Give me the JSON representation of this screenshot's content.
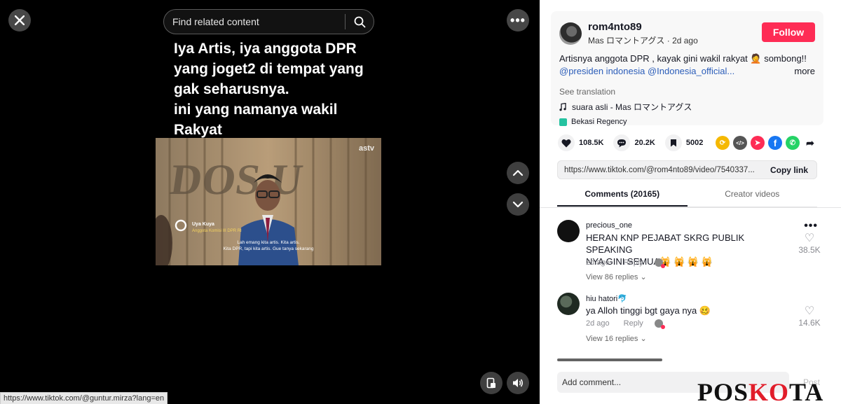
{
  "player": {
    "search_placeholder": "Find related content",
    "caption_lines": [
      "Iya Artis, iya anggota DPR",
      "yang joget2 di tempat yang",
      "gak seharusnya.",
      "ini yang namanya wakil",
      "Rakyat"
    ],
    "video_overlay": {
      "brand": "astv",
      "name": "Uya Kuya",
      "role": "Anggota Komisi III DPR RI",
      "subtitle_1": "Lah emang kita artis. Kita artis.",
      "subtitle_2": "Kita DPR, tapi kita artis. Gue tanya sekarang"
    },
    "status_url": "https://www.tiktok.com/@guntur.mirza?lang=en"
  },
  "post": {
    "username": "rom4nto89",
    "subline": "Mas ロマントアグス · 2d ago",
    "follow_label": "Follow",
    "description": "Artisnya anggota DPR , kayak gini wakil rakyat 🤦 sombong!!",
    "mentions": "@presiden indonesia @Indonesia_official...",
    "more_label": "more",
    "see_translation": "See translation",
    "music": "suara asli - Mas ロマントアグス",
    "location": "Bekasi Regency"
  },
  "stats": {
    "likes": "108.5K",
    "comments": "20.2K",
    "saves": "5002"
  },
  "share": {
    "link": "https://www.tiktok.com/@rom4nto89/video/7540337...",
    "copy_label": "Copy link"
  },
  "tabs": [
    {
      "label": "Comments (20165)",
      "active": true
    },
    {
      "label": "Creator videos",
      "active": false
    }
  ],
  "comments": [
    {
      "user": "precious_one",
      "line1": "HERAN KNP PEJABAT SKRG PUBLIK SPEAKING",
      "line2": "NYA GINI SEMUA🙀 🙀 🙀 🙀",
      "time": "2d ago",
      "reply": "Reply",
      "likes": "38.5K",
      "view_replies": "View 86 replies"
    },
    {
      "user": "hiu hatori🐬",
      "line1": "ya Alloh tinggi bgt gaya nya 🥴",
      "time": "2d ago",
      "reply": "Reply",
      "likes": "14.6K",
      "view_replies": "View 16 replies"
    }
  ],
  "comment_box": {
    "placeholder": "Add comment...",
    "post_label": "Post"
  },
  "watermark": {
    "part1": "POS",
    "part2": "KO",
    "part3": "TA"
  },
  "colors": {
    "accent": "#fe2c55",
    "mention": "#2b5db9",
    "background_left": "#000000"
  }
}
